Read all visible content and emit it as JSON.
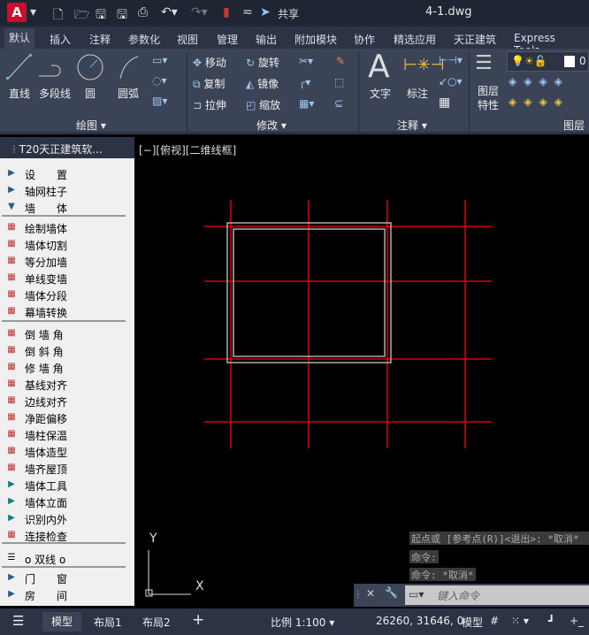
{
  "title": {
    "app_icon": "A",
    "filename": "4-1.dwg",
    "share": "共享"
  },
  "tabs": [
    "默认",
    "插入",
    "注释",
    "参数化",
    "视图",
    "管理",
    "输出",
    "附加模块",
    "协作",
    "精选应用",
    "天正建筑",
    "Express Tools"
  ],
  "ribbon": {
    "draw": {
      "label": "绘图",
      "line": "直线",
      "polyline": "多段线",
      "circle": "圆",
      "arc": "圆弧"
    },
    "modify": {
      "label": "修改",
      "move": "移动",
      "rotate": "旋转",
      "copy": "复制",
      "mirror": "镜像",
      "stretch": "拉伸",
      "scale": "缩放"
    },
    "annotation": {
      "label": "注释",
      "text": "文字",
      "dimension": "标注"
    },
    "layers": {
      "label": "图层",
      "properties": "图层\n特性",
      "current_layer": "0"
    }
  },
  "palette": {
    "title": "T20天正建筑软...",
    "items": [
      {
        "label": "设　　置",
        "icon": "triangle-right"
      },
      {
        "label": "轴网柱子",
        "icon": "triangle-right"
      },
      {
        "label": "墙　　体",
        "icon": "triangle-down"
      },
      {
        "label": "绘制墙体",
        "icon": "draw-wall"
      },
      {
        "label": "墙体切割",
        "icon": "cut-wall"
      },
      {
        "label": "等分加墙",
        "icon": "divide-wall"
      },
      {
        "label": "单线变墙",
        "icon": "line-to-wall"
      },
      {
        "label": "墙体分段",
        "icon": "segment-wall"
      },
      {
        "label": "幕墙转换",
        "icon": "curtain-wall"
      },
      {
        "label": "倒 墙 角",
        "icon": "fillet-wall"
      },
      {
        "label": "倒 斜 角",
        "icon": "chamfer-wall"
      },
      {
        "label": "修 墙 角",
        "icon": "fix-corner"
      },
      {
        "label": "基线对齐",
        "icon": "baseline-align"
      },
      {
        "label": "边线对齐",
        "icon": "edge-align"
      },
      {
        "label": "净距偏移",
        "icon": "offset"
      },
      {
        "label": "墙柱保温",
        "icon": "insulation"
      },
      {
        "label": "墙体造型",
        "icon": "wall-shape"
      },
      {
        "label": "墙齐屋顶",
        "icon": "roof"
      },
      {
        "label": "墙体工具",
        "icon": "triangle-right"
      },
      {
        "label": "墙体立面",
        "icon": "triangle-right"
      },
      {
        "label": "识别内外",
        "icon": "triangle-right"
      },
      {
        "label": "连接检查",
        "icon": "check"
      },
      {
        "label": "o 双线 o",
        "icon": "double-line"
      },
      {
        "label": "门　　窗",
        "icon": "triangle-right"
      },
      {
        "label": "房　　间",
        "icon": "triangle-right"
      }
    ]
  },
  "viewport": {
    "label": "[−][俯视][二维线框]",
    "ucs_x": "X",
    "ucs_y": "Y"
  },
  "command": {
    "history": [
      "起点或 [参考点(R)]<退出>: *取消*",
      "命令:",
      "命令: *取消*"
    ],
    "placeholder": "键入命令"
  },
  "status": {
    "tabs": [
      "模型",
      "布局1",
      "布局2"
    ],
    "add": "+",
    "scale": "比例 1:100",
    "coords": "26260, 31646, 0",
    "space": "模型"
  },
  "colors": {
    "grid_axis": "#ff0000",
    "wall": "#c8c8c8",
    "background": "#000000",
    "accent": "#c8102e"
  }
}
